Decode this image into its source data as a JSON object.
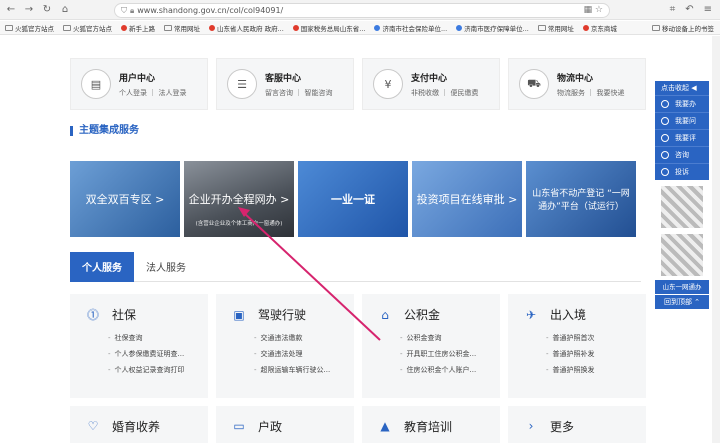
{
  "browser": {
    "url": "www.shandong.gov.cn/col/col94091/",
    "bookmarks": [
      "火狐官方站点",
      "火狐官方站点",
      "新手上路",
      "常用网址",
      "山东省人民政府 政府...",
      "国家税务总局山东省...",
      "济南市社会保险单位...",
      "济南市医疗保障单位...",
      "常用网址",
      "京东商城"
    ],
    "bookmarks_right": "移动设备上的书签"
  },
  "centers": [
    {
      "icon": "user-center-icon",
      "glyph": "▤",
      "title": "用户中心",
      "sub": "个人登录 ｜ 法人登录"
    },
    {
      "icon": "chat-icon",
      "glyph": "☰",
      "title": "客服中心",
      "sub": "留言咨询 ｜ 智能咨询"
    },
    {
      "icon": "yen-icon",
      "glyph": "¥",
      "title": "支付中心",
      "sub": "非税收缴 ｜ 便民缴费"
    },
    {
      "icon": "truck-icon",
      "glyph": "⛟",
      "title": "物流中心",
      "sub": "物流服务 ｜ 我要快递"
    }
  ],
  "section_title": "主题集成服务",
  "banners": [
    {
      "text": "双全双百专区 >",
      "sub": "",
      "color": "#3a6fb0"
    },
    {
      "text": "企业开办全程网办 >",
      "sub": "(含营业企业及个体工商户一窗通办)",
      "color": "#5a6470"
    },
    {
      "text": "一业一证",
      "sub": "",
      "color": "#2f6fc0"
    },
    {
      "text": "投资项目在线审批 >",
      "sub": "",
      "color": "#4a7fc8"
    },
    {
      "text": "山东省不动产登记 “一网通办”平台（试运行）",
      "sub": "",
      "color": "#2e62a8"
    }
  ],
  "tabs": [
    "个人服务",
    "法人服务"
  ],
  "services": [
    {
      "icon": "social-security-icon",
      "glyph": "⓵",
      "title": "社保",
      "items": [
        "社保查询",
        "个人参保缴费证明查...",
        "个人权益记录查询打印"
      ]
    },
    {
      "icon": "car-icon",
      "glyph": "▣",
      "title": "驾驶行驶",
      "items": [
        "交通违法缴款",
        "交通违法处理",
        "超限运输车辆行驶公..."
      ]
    },
    {
      "icon": "house-icon",
      "glyph": "⌂",
      "title": "公积金",
      "items": [
        "公积金查询",
        "开具职工住房公积金...",
        "住房公积金个人账户..."
      ]
    },
    {
      "icon": "plane-icon",
      "glyph": "✈",
      "title": "出入境",
      "items": [
        "普通护照首次",
        "普通护照补发",
        "普通护照换发"
      ]
    }
  ],
  "services2": [
    {
      "icon": "heart-icon",
      "glyph": "♡",
      "title": "婚育收养"
    },
    {
      "icon": "id-card-icon",
      "glyph": "▭",
      "title": "户政"
    },
    {
      "icon": "graduation-icon",
      "glyph": "▲",
      "title": "教育培训"
    },
    {
      "icon": "more-icon",
      "glyph": "›",
      "title": "更多"
    }
  ],
  "float_panel": {
    "head": "点击收起 ◀",
    "items": [
      "我要办",
      "我要问",
      "我要评",
      "咨询",
      "投诉"
    ],
    "qr_label": "山东一网通办",
    "top": "回到顶部 ⌃"
  },
  "colors": {
    "accent": "#2a64c2",
    "annotation": "#d6246e"
  }
}
